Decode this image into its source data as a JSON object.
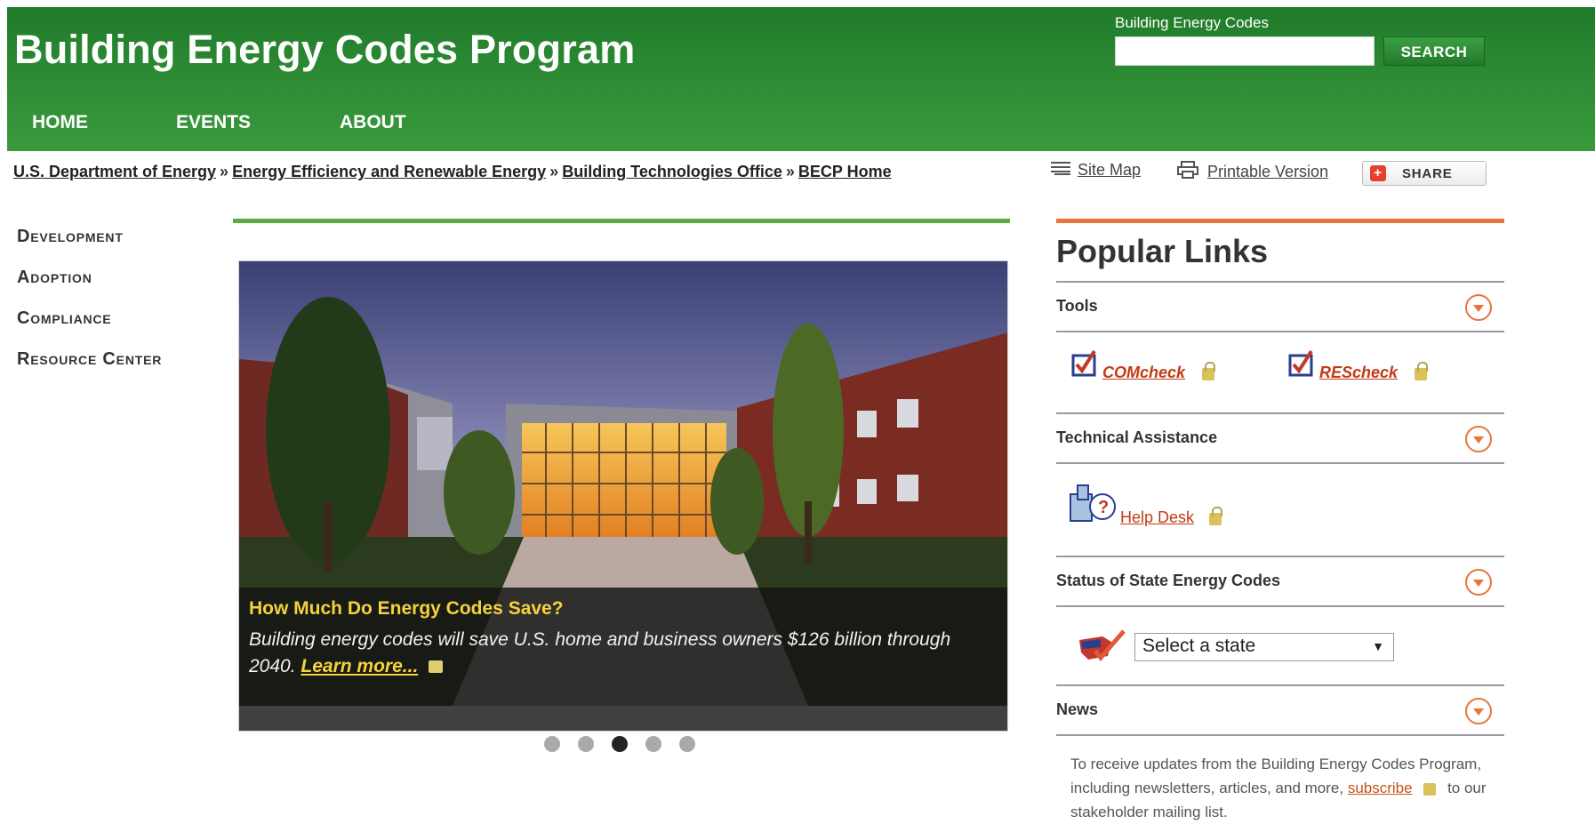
{
  "header": {
    "title": "Building Energy Codes Program",
    "search_label": "Building Energy Codes",
    "search_value": "",
    "search_button": "SEARCH",
    "nav": [
      "HOME",
      "EVENTS",
      "ABOUT"
    ]
  },
  "breadcrumb": [
    "U.S. Department of Energy",
    "Energy Efficiency and Renewable Energy",
    "Building Technologies Office",
    "BECP Home"
  ],
  "breadcrumb_sep": "»",
  "utilities": {
    "site_map": "Site Map",
    "printable": "Printable Version",
    "share": "SHARE"
  },
  "left_nav": [
    "Development",
    "Adoption",
    "Compliance",
    "Resource Center"
  ],
  "slider": {
    "headline": "How Much Do Energy Codes Save?",
    "text": "Building energy codes will save U.S. home and business owners $126 billion through 2040.",
    "link": "Learn more...",
    "dots": 5,
    "active_dot": 3
  },
  "popular": {
    "title": "Popular Links",
    "sections": {
      "tools": "Tools",
      "technical": "Technical Assistance",
      "status": "Status of State Energy Codes",
      "news": "News"
    },
    "tools": [
      "COMcheck",
      "REScheck"
    ],
    "help_desk": "Help Desk",
    "state_select": "Select a state",
    "news_text_1": "To receive updates from the Building Energy Codes Program, including newsletters, articles, and more,",
    "news_link": "subscribe",
    "news_text_2": "to our stakeholder mailing list."
  },
  "colors": {
    "header_green": "#2c8a33",
    "accent_orange": "#e8743b",
    "caption_yellow": "#f3d23c",
    "link_red": "#c23a14"
  }
}
